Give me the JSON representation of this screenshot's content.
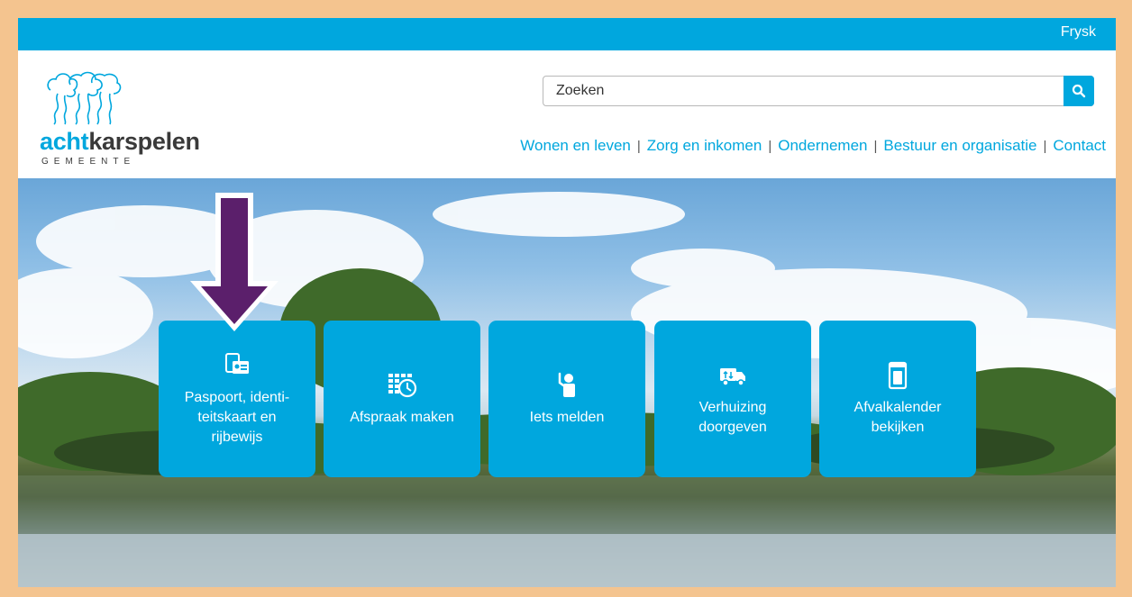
{
  "topbar": {
    "language_link": "Frysk"
  },
  "brand": {
    "word_part1": "acht",
    "word_part2": "karspelen",
    "subtitle": "GEMEENTE"
  },
  "search": {
    "placeholder": "Zoeken",
    "button_icon": "search-icon"
  },
  "nav": [
    {
      "label": "Wonen en leven"
    },
    {
      "label": "Zorg en inkomen"
    },
    {
      "label": "Ondernemen"
    },
    {
      "label": "Bestuur en organisatie"
    },
    {
      "label": "Contact"
    }
  ],
  "tiles": [
    {
      "label": "Paspoort, identi-\nteitskaart en\nrijbewijs",
      "icon": "id-card-icon"
    },
    {
      "label": "Afspraak maken",
      "icon": "calendar-clock-icon"
    },
    {
      "label": "Iets melden",
      "icon": "report-person-icon"
    },
    {
      "label": "Verhuizing\ndoorgeven",
      "icon": "moving-truck-icon"
    },
    {
      "label": "Afvalkalender\nbekijken",
      "icon": "waste-bin-icon"
    }
  ],
  "annotation": {
    "arrow_color": "#5b1f6b"
  },
  "colors": {
    "brand_blue": "#00a7de",
    "frame": "#f4c48f"
  }
}
